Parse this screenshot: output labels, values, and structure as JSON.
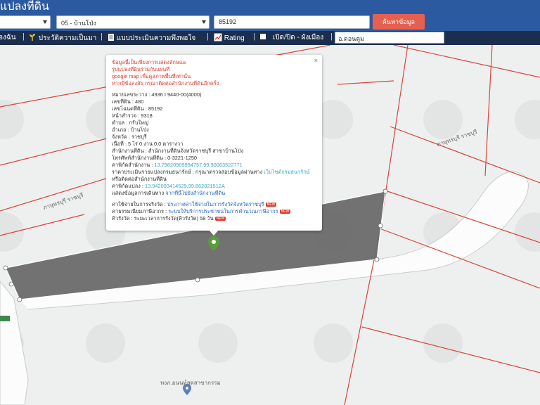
{
  "header": {
    "title": "แปลงที่ดิน",
    "province_select": "",
    "district_select": "05 - บ้านโป่ง",
    "parcel_input": "85192",
    "search_button": "ค้นหาข้อมูล"
  },
  "toolbar": {
    "item1": "องฉัน",
    "sep": "|",
    "item2": "ประวัติความเป็นมา",
    "item3": "แบบประเมินความพึงพอใจ",
    "item4": "Rating",
    "item5": "เปิด/ปิด - ผังเมือง",
    "search_value": "อ.ดอนตูม"
  },
  "popup": {
    "close": "×",
    "note1": "ข้อมูลนี้เป็นเพียงการแสดงลักษณะ",
    "note2": "รูปแปลงที่ดินร่วมกับแผนที่",
    "note3": "google map เพื่อดูสภาพพื้นที่เท่านั้น",
    "note4": "หากมีข้อสงสัย กรุณาติดต่อสำนักงานที่ดินอีกครั้ง",
    "survey": "หมายเลขระวาง : 4936 I 9440-00(4000)",
    "land_no": "เลขที่ดิน : 480",
    "deed_no": "เลขโฉนดที่ดิน : 85192",
    "page_no": "หน้าสำรวจ : 9318",
    "tambon": "ตำบล : กรับใหญ่",
    "amphoe": "อำเภอ : บ้านโป่ง",
    "province": "จังหวัด : ราชบุรี",
    "area": "เนื้อที่ : 5 ไร่ 0 งาน 0.0 ตารางวา",
    "office": "สำนักงานที่ดิน : สำนักงานที่ดินจังหวัดราชบุรี สาขาบ้านโป่ง",
    "phone": "โทรศัพท์สำนักงานที่ดิน : 0-3221-1250",
    "office_coord_label": "ค่าพิกัดสำนักงาน : ",
    "office_coord_value": "13.79820909994757,99.90063522771",
    "price_label": "ราคาประเมินรายแปลงกรมธนารักษ์ : กรุณาตรวจสอบข้อมูลผ่านทาง ",
    "price_link": "เว็บไซต์กรมธนารักษ์",
    "price_or": "หรือติดต่อสำนักงานที่ดิน",
    "parcel_coord_label": "ค่าพิกัดแปลง : ",
    "parcel_coord_value": "13.942093414529,99.862021512A",
    "route_label": "แสดงข้อมูลการเดินทาง ",
    "route_link": "จากที่นี่ไปยังสำนักงานที่ดิน",
    "auction_label": "ค่าใช้จ่ายในการจริงวัด : ",
    "auction_link": "ประกาศค่าใช้จ่ายในการรังวัดจังหวัดราชบุรี",
    "fee_label": "ค่าธรรมเนียมภาษีอากร : ",
    "fee_link": "ระบบให้บริการประชาชนในการคำนวณภาษีอากร",
    "wait_label": "คิวรังวัด : ระยะเวลาการรังวัด(คิวรังวัด) 58 วัน",
    "new_badge": "NEW"
  },
  "map": {
    "label_top_right": "ภาษุทรบุรี ราชบุรี",
    "label_left": "ภาษุทรบุรี ราชบุรี",
    "poi_label": "ทงภ.อนนท์สูดสาขากรรม",
    "parcel_color": "#6a6a6a",
    "boundary_color": "#d9443b",
    "pin_color": "#5a9e3a"
  }
}
